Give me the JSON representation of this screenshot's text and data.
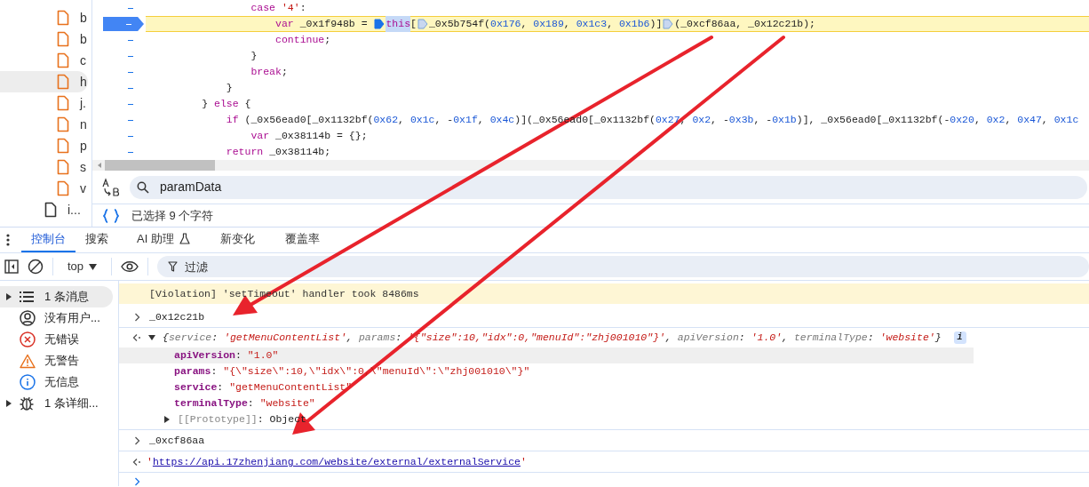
{
  "file_tree": [
    {
      "name": "b",
      "kind": "script",
      "selected": false
    },
    {
      "name": "b",
      "kind": "script",
      "selected": false
    },
    {
      "name": "c",
      "kind": "script",
      "selected": false
    },
    {
      "name": "h",
      "kind": "script",
      "selected": true
    },
    {
      "name": "j.",
      "kind": "script",
      "selected": false
    },
    {
      "name": "n",
      "kind": "script",
      "selected": false
    },
    {
      "name": "p",
      "kind": "script",
      "selected": false
    },
    {
      "name": "s",
      "kind": "script",
      "selected": false
    },
    {
      "name": "v",
      "kind": "script",
      "selected": false
    },
    {
      "name": "i...",
      "kind": "document",
      "selected": false
    }
  ],
  "code_lines": [
    {
      "breakpoint": false,
      "tokens": [
        {
          "kind": "keyword",
          "text": "                case "
        },
        {
          "kind": "string",
          "text": "'4'"
        },
        {
          "kind": "plain",
          "text": ":"
        }
      ]
    },
    {
      "breakpoint": true,
      "tokens": [
        {
          "kind": "keyword",
          "text": "                    var"
        },
        {
          "kind": "plain",
          "text": " _0x1f948b = "
        },
        {
          "kind": "marker",
          "active": true
        },
        {
          "kind": "keyword",
          "text": "this",
          "selected": true
        },
        {
          "kind": "plain",
          "text": "["
        },
        {
          "kind": "marker",
          "active": false
        },
        {
          "kind": "plain",
          "text": "_0x5b754f("
        },
        {
          "kind": "number",
          "text": "0x176"
        },
        {
          "kind": "plain",
          "text": ", "
        },
        {
          "kind": "number",
          "text": "0x189"
        },
        {
          "kind": "plain",
          "text": ", "
        },
        {
          "kind": "number",
          "text": "0x1c3"
        },
        {
          "kind": "plain",
          "text": ", "
        },
        {
          "kind": "number",
          "text": "0x1b6"
        },
        {
          "kind": "plain",
          "text": ")]"
        },
        {
          "kind": "marker",
          "active": false
        },
        {
          "kind": "plain",
          "text": "(_0xcf86aa, _0x12c21b);"
        }
      ]
    },
    {
      "breakpoint": false,
      "tokens": [
        {
          "kind": "keyword",
          "text": "                    continue"
        },
        {
          "kind": "plain",
          "text": ";"
        }
      ]
    },
    {
      "breakpoint": false,
      "tokens": [
        {
          "kind": "plain",
          "text": "                }"
        }
      ]
    },
    {
      "breakpoint": false,
      "tokens": [
        {
          "kind": "keyword",
          "text": "                break"
        },
        {
          "kind": "plain",
          "text": ";"
        }
      ]
    },
    {
      "breakpoint": false,
      "tokens": [
        {
          "kind": "plain",
          "text": "            }"
        }
      ]
    },
    {
      "breakpoint": false,
      "tokens": [
        {
          "kind": "plain",
          "text": "        } "
        },
        {
          "kind": "keyword",
          "text": "else"
        },
        {
          "kind": "plain",
          "text": " {"
        }
      ]
    },
    {
      "breakpoint": false,
      "tokens": [
        {
          "kind": "keyword",
          "text": "            if"
        },
        {
          "kind": "plain",
          "text": " (_0x56ead0[_0x1132bf("
        },
        {
          "kind": "number",
          "text": "0x62"
        },
        {
          "kind": "plain",
          "text": ", "
        },
        {
          "kind": "number",
          "text": "0x1c"
        },
        {
          "kind": "plain",
          "text": ", -"
        },
        {
          "kind": "number",
          "text": "0x1f"
        },
        {
          "kind": "plain",
          "text": ", "
        },
        {
          "kind": "number",
          "text": "0x4c"
        },
        {
          "kind": "plain",
          "text": ")](_0x56ead0[_0x1132bf("
        },
        {
          "kind": "number",
          "text": "0x27"
        },
        {
          "kind": "plain",
          "text": ", "
        },
        {
          "kind": "number",
          "text": "0x2"
        },
        {
          "kind": "plain",
          "text": ", -"
        },
        {
          "kind": "number",
          "text": "0x3b"
        },
        {
          "kind": "plain",
          "text": ", -"
        },
        {
          "kind": "number",
          "text": "0x1b"
        },
        {
          "kind": "plain",
          "text": ")], _0x56ead0[_0x1132bf(-"
        },
        {
          "kind": "number",
          "text": "0x20"
        },
        {
          "kind": "plain",
          "text": ", "
        },
        {
          "kind": "number",
          "text": "0x2"
        },
        {
          "kind": "plain",
          "text": ", "
        },
        {
          "kind": "number",
          "text": "0x47"
        },
        {
          "kind": "plain",
          "text": ", "
        },
        {
          "kind": "number",
          "text": "0x1c"
        }
      ]
    },
    {
      "breakpoint": false,
      "tokens": [
        {
          "kind": "keyword",
          "text": "                var"
        },
        {
          "kind": "plain",
          "text": " _0x38114b = {};"
        }
      ]
    },
    {
      "breakpoint": false,
      "tokens": [
        {
          "kind": "keyword",
          "text": "            return"
        },
        {
          "kind": "plain",
          "text": " _0x38114b;"
        }
      ]
    }
  ],
  "search": {
    "value": "paramData"
  },
  "selection_status": "已选择 9 个字符",
  "tabs": [
    {
      "label": "控制台",
      "selected": true,
      "experimental": false
    },
    {
      "label": "搜索",
      "selected": false,
      "experimental": false
    },
    {
      "label": "AI 助理",
      "selected": false,
      "experimental": true
    },
    {
      "label": "新变化",
      "selected": false,
      "experimental": false
    },
    {
      "label": "覆盖率",
      "selected": false,
      "experimental": false
    }
  ],
  "toolbar": {
    "context": "top",
    "filter_placeholder": "过滤"
  },
  "console_sidebar": [
    {
      "label": "1 条消息",
      "kind": "messages",
      "selected": true,
      "expanded": false
    },
    {
      "label": "没有用户...",
      "kind": "user",
      "selected": false
    },
    {
      "label": "无错误",
      "kind": "error",
      "selected": false
    },
    {
      "label": "无警告",
      "kind": "warning",
      "selected": false
    },
    {
      "label": "无信息",
      "kind": "info",
      "selected": false
    },
    {
      "label": "1 条详细...",
      "kind": "verbose",
      "selected": false,
      "expanded": false
    }
  ],
  "console_messages": [
    {
      "kind": "violation",
      "text": "[Violation] 'setTimeout' handler took 8486ms"
    },
    {
      "kind": "input",
      "text": "_0x12c21b"
    },
    {
      "kind": "object",
      "expanded": true,
      "preview": [
        {
          "kind": "punct",
          "text": "{"
        },
        {
          "kind": "key",
          "text": "service"
        },
        {
          "kind": "punct",
          "text": ": "
        },
        {
          "kind": "value",
          "text": "'getMenuContentList'"
        },
        {
          "kind": "punct",
          "text": ", "
        },
        {
          "kind": "key",
          "text": "params"
        },
        {
          "kind": "punct",
          "text": ": "
        },
        {
          "kind": "value",
          "text": "'{\"size\":10,\"idx\":0,\"menuId\":\"zhj001010\"}'"
        },
        {
          "kind": "punct",
          "text": ", "
        },
        {
          "kind": "key",
          "text": "apiVersion"
        },
        {
          "kind": "punct",
          "text": ": "
        },
        {
          "kind": "value",
          "text": "'1.0'"
        },
        {
          "kind": "punct",
          "text": ", "
        },
        {
          "kind": "key",
          "text": "terminalType"
        },
        {
          "kind": "punct",
          "text": ": "
        },
        {
          "kind": "value",
          "text": "'website'"
        },
        {
          "kind": "punct",
          "text": "}"
        }
      ],
      "info_badge": "i",
      "properties": [
        {
          "kind": "property",
          "key": "apiVersion",
          "separator": ": ",
          "value": "\"1.0\"",
          "selected": true
        },
        {
          "kind": "property",
          "key": "params",
          "separator": ": ",
          "value": "\"{\\\"size\\\":10,\\\"idx\\\":0,\\\"menuId\\\":\\\"zhj001010\\\"}\"",
          "selected": false
        },
        {
          "kind": "property",
          "key": "service",
          "separator": ": ",
          "value": "\"getMenuContentList\"",
          "selected": false
        },
        {
          "kind": "property",
          "key": "terminalType",
          "separator": ": ",
          "value": "\"website\"",
          "selected": false
        },
        {
          "kind": "prototype",
          "key": "[[Prototype]]",
          "separator": ": ",
          "value": "Object",
          "selected": false,
          "expanded": false
        }
      ]
    },
    {
      "kind": "input",
      "text": "_0xcf86aa"
    },
    {
      "kind": "link",
      "quote_open": "'",
      "text": "https://api.17zhenjiang.com/website/external/externalService",
      "quote_close": "'"
    },
    {
      "kind": "prompt"
    }
  ]
}
